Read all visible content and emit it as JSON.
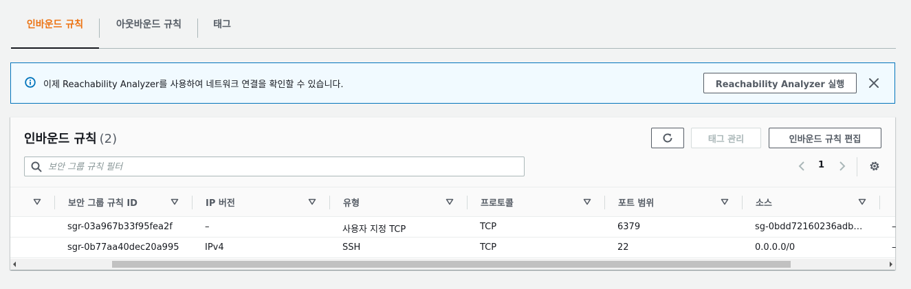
{
  "tabs": [
    {
      "label": "인바운드 규칙",
      "active": true
    },
    {
      "label": "아웃바운드 규칙",
      "active": false
    },
    {
      "label": "태그",
      "active": false
    }
  ],
  "flash": {
    "icon": "info-icon",
    "message": "이제 Reachability Analyzer를 사용하여 네트워크 연결을 확인할 수 있습니다.",
    "button_label": "Reachability Analyzer 실행",
    "close_icon": "close-icon"
  },
  "panel": {
    "title": "인바운드 규칙",
    "count": "(2)",
    "refresh_icon": "refresh-icon",
    "manage_tags_label": "태그 관리",
    "edit_rules_label": "인바운드 규칙 편집",
    "search_placeholder": "보안 그룹 규칙 필터",
    "page_number": "1"
  },
  "table": {
    "columns": [
      "보안 그룹 규칙 ID",
      "IP 버전",
      "유형",
      "프로토콜",
      "포트 범위",
      "소스"
    ],
    "rows": [
      {
        "rule_id": "sgr-03a967b33f95fea2f",
        "ip_version": "–",
        "type": "사용자 지정 TCP",
        "protocol": "TCP",
        "port_range": "6379",
        "source": "sg-0bdd72160236adb…",
        "extra": "–"
      },
      {
        "rule_id": "sgr-0b77aa40dec20a995",
        "ip_version": "IPv4",
        "type": "SSH",
        "protocol": "TCP",
        "port_range": "22",
        "source": "0.0.0.0/0",
        "extra": "–"
      }
    ]
  },
  "colors": {
    "accent": "#ec7211",
    "info_blue": "#0073bb",
    "info_bg": "#f1faff",
    "text": "#16191f",
    "muted": "#545b64"
  }
}
